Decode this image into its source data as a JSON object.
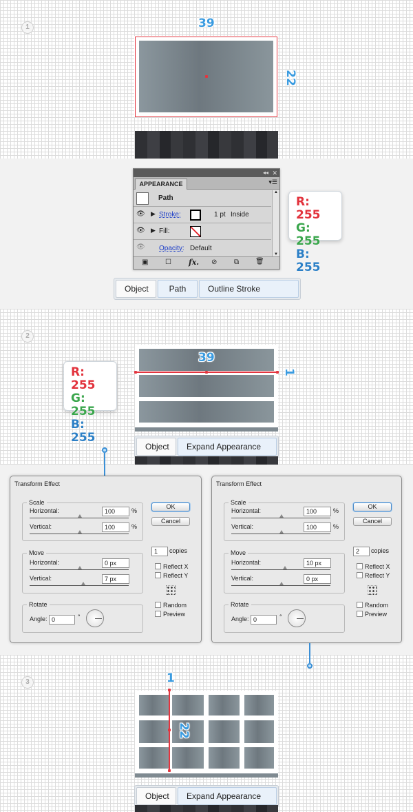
{
  "steps": {
    "step1": "1",
    "step2": "2",
    "step3": "3"
  },
  "dimensions": {
    "width_39_top": "39",
    "height_22_top": "22",
    "width_39_mid": "39",
    "height_1_mid": "1",
    "width_1_bottom": "1",
    "height_22_bottom": "22"
  },
  "rgb_top": {
    "r": "R: 255",
    "g": "G: 255",
    "b": "B: 255"
  },
  "rgb_mid": {
    "r": "R: 255",
    "g": "G: 255",
    "b": "B: 255"
  },
  "colors": {
    "r": "#e2323c",
    "g": "#3aa64c",
    "b": "#2b7fc6",
    "accent_blue": "#3a9be0",
    "guide_red": "#e3353f"
  },
  "appearance": {
    "tab": "APPEARANCE",
    "path_label": "Path",
    "stroke_label": "Stroke:",
    "stroke_value": "1 pt",
    "stroke_align": "Inside",
    "fill_label": "Fill:",
    "opacity_label": "Opacity:",
    "opacity_value": "Default",
    "fx_label": "fx."
  },
  "breadcrumb1": {
    "items": [
      "Object",
      "Path",
      "Outline Stroke"
    ]
  },
  "breadcrumb2": {
    "items": [
      "Object",
      "Expand Appearance"
    ]
  },
  "breadcrumb3": {
    "items": [
      "Object",
      "Expand Appearance"
    ]
  },
  "transform_left": {
    "title": "Transform Effect",
    "scale_label": "Scale",
    "horizontal_label": "Horizontal:",
    "horizontal_value": "100",
    "horizontal_unit": "%",
    "vertical_label": "Vertical:",
    "vertical_value": "100",
    "vertical_unit": "%",
    "move_label": "Move",
    "move_h_label": "Horizontal:",
    "move_h_value": "0 px",
    "move_v_label": "Vertical:",
    "move_v_value": "7 px",
    "rotate_label": "Rotate",
    "angle_label": "Angle:",
    "angle_value": "0",
    "degree": "°",
    "ok": "OK",
    "cancel": "Cancel",
    "copies_value": "1",
    "copies_label": "copies",
    "reflect_x": "Reflect X",
    "reflect_y": "Reflect Y",
    "random": "Random",
    "preview": "Preview"
  },
  "transform_right": {
    "title": "Transform Effect",
    "scale_label": "Scale",
    "horizontal_label": "Horizontal:",
    "horizontal_value": "100",
    "horizontal_unit": "%",
    "vertical_label": "Vertical:",
    "vertical_value": "100",
    "vertical_unit": "%",
    "move_label": "Move",
    "move_h_label": "Horizontal:",
    "move_h_value": "10 px",
    "move_v_label": "Vertical:",
    "move_v_value": "0 px",
    "rotate_label": "Rotate",
    "angle_label": "Angle:",
    "angle_value": "0",
    "degree": "°",
    "ok": "OK",
    "cancel": "Cancel",
    "copies_value": "2",
    "copies_label": "copies",
    "reflect_x": "Reflect X",
    "reflect_y": "Reflect Y",
    "random": "Random",
    "preview": "Preview"
  }
}
